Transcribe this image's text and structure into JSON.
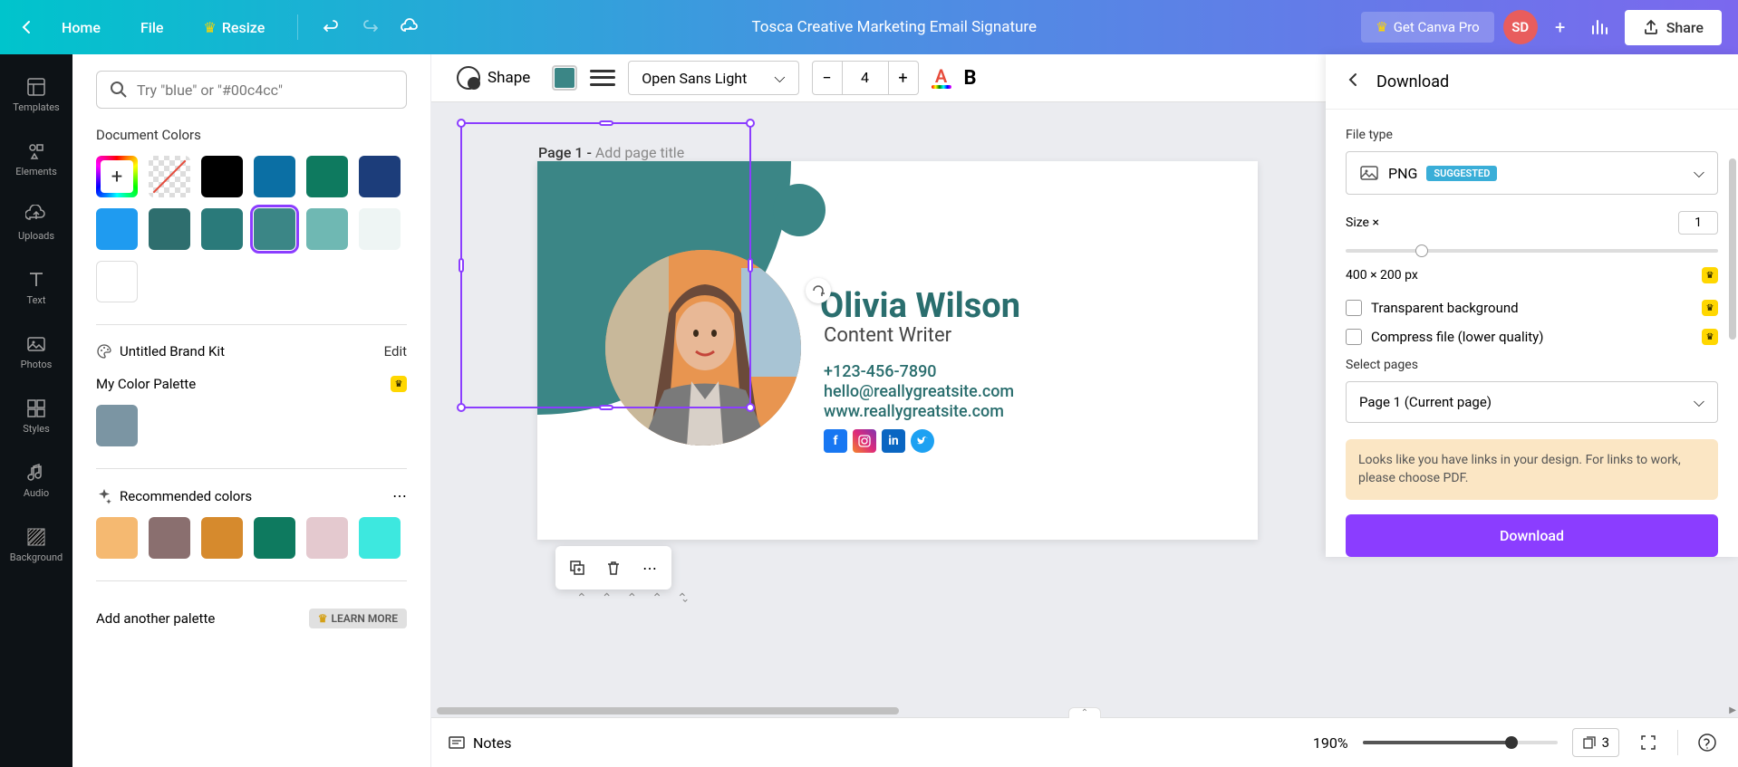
{
  "header": {
    "home": "Home",
    "file": "File",
    "resize": "Resize",
    "title": "Tosca Creative Marketing Email Signature",
    "get_pro": "Get Canva Pro",
    "avatar_initials": "SD",
    "share": "Share"
  },
  "sidebar": {
    "items": [
      {
        "label": "Templates"
      },
      {
        "label": "Elements"
      },
      {
        "label": "Uploads"
      },
      {
        "label": "Text"
      },
      {
        "label": "Photos"
      },
      {
        "label": "Styles"
      },
      {
        "label": "Audio"
      },
      {
        "label": "Background"
      }
    ]
  },
  "left_panel": {
    "search_placeholder": "Try \"blue\" or \"#00c4cc\"",
    "document_colors_title": "Document Colors",
    "doc_colors": [
      "#000000",
      "#0b6fa4",
      "#0e7a5f",
      "#1c3d7a",
      "#1f9bf0",
      "#2e6e6e",
      "#2a7a7a",
      "#3b8686",
      "#6fb8b3",
      "#eef5f4",
      "#ffffff"
    ],
    "brand_kit_label": "Untitled Brand Kit",
    "edit_label": "Edit",
    "palette_label": "My Color Palette",
    "palette_colors": [
      "#7b95a3"
    ],
    "rec_title": "Recommended colors",
    "rec_colors": [
      "#f5b971",
      "#8a6f6f",
      "#d68a2d",
      "#0e7a5f",
      "#e4c9cf",
      "#3de8df"
    ],
    "add_palette": "Add another palette",
    "learn_more": "LEARN MORE"
  },
  "toolbar": {
    "shape_label": "Shape",
    "shape_color": "#3b8686",
    "font": "Open Sans Light",
    "size": "4"
  },
  "canvas": {
    "page_label_prefix": "Page 1 - ",
    "page_label_placeholder": "Add page title"
  },
  "signature": {
    "name": "Olivia Wilson",
    "title": "Content Writer",
    "phone": "+123-456-7890",
    "email": "hello@reallygreatsite.com",
    "web": "www.reallygreatsite.com"
  },
  "download": {
    "title": "Download",
    "file_type_label": "File type",
    "file_type": "PNG",
    "suggested": "SUGGESTED",
    "size_label": "Size ×",
    "size_value": "1",
    "dimensions": "400 × 200 px",
    "transparent": "Transparent background",
    "compress": "Compress file (lower quality)",
    "select_pages": "Select pages",
    "page_selection": "Page 1 (Current page)",
    "warning": "Looks like you have links in your design. For links to work, please choose PDF.",
    "button": "Download"
  },
  "bottom": {
    "notes": "Notes",
    "zoom": "190%",
    "page_count": "3"
  }
}
